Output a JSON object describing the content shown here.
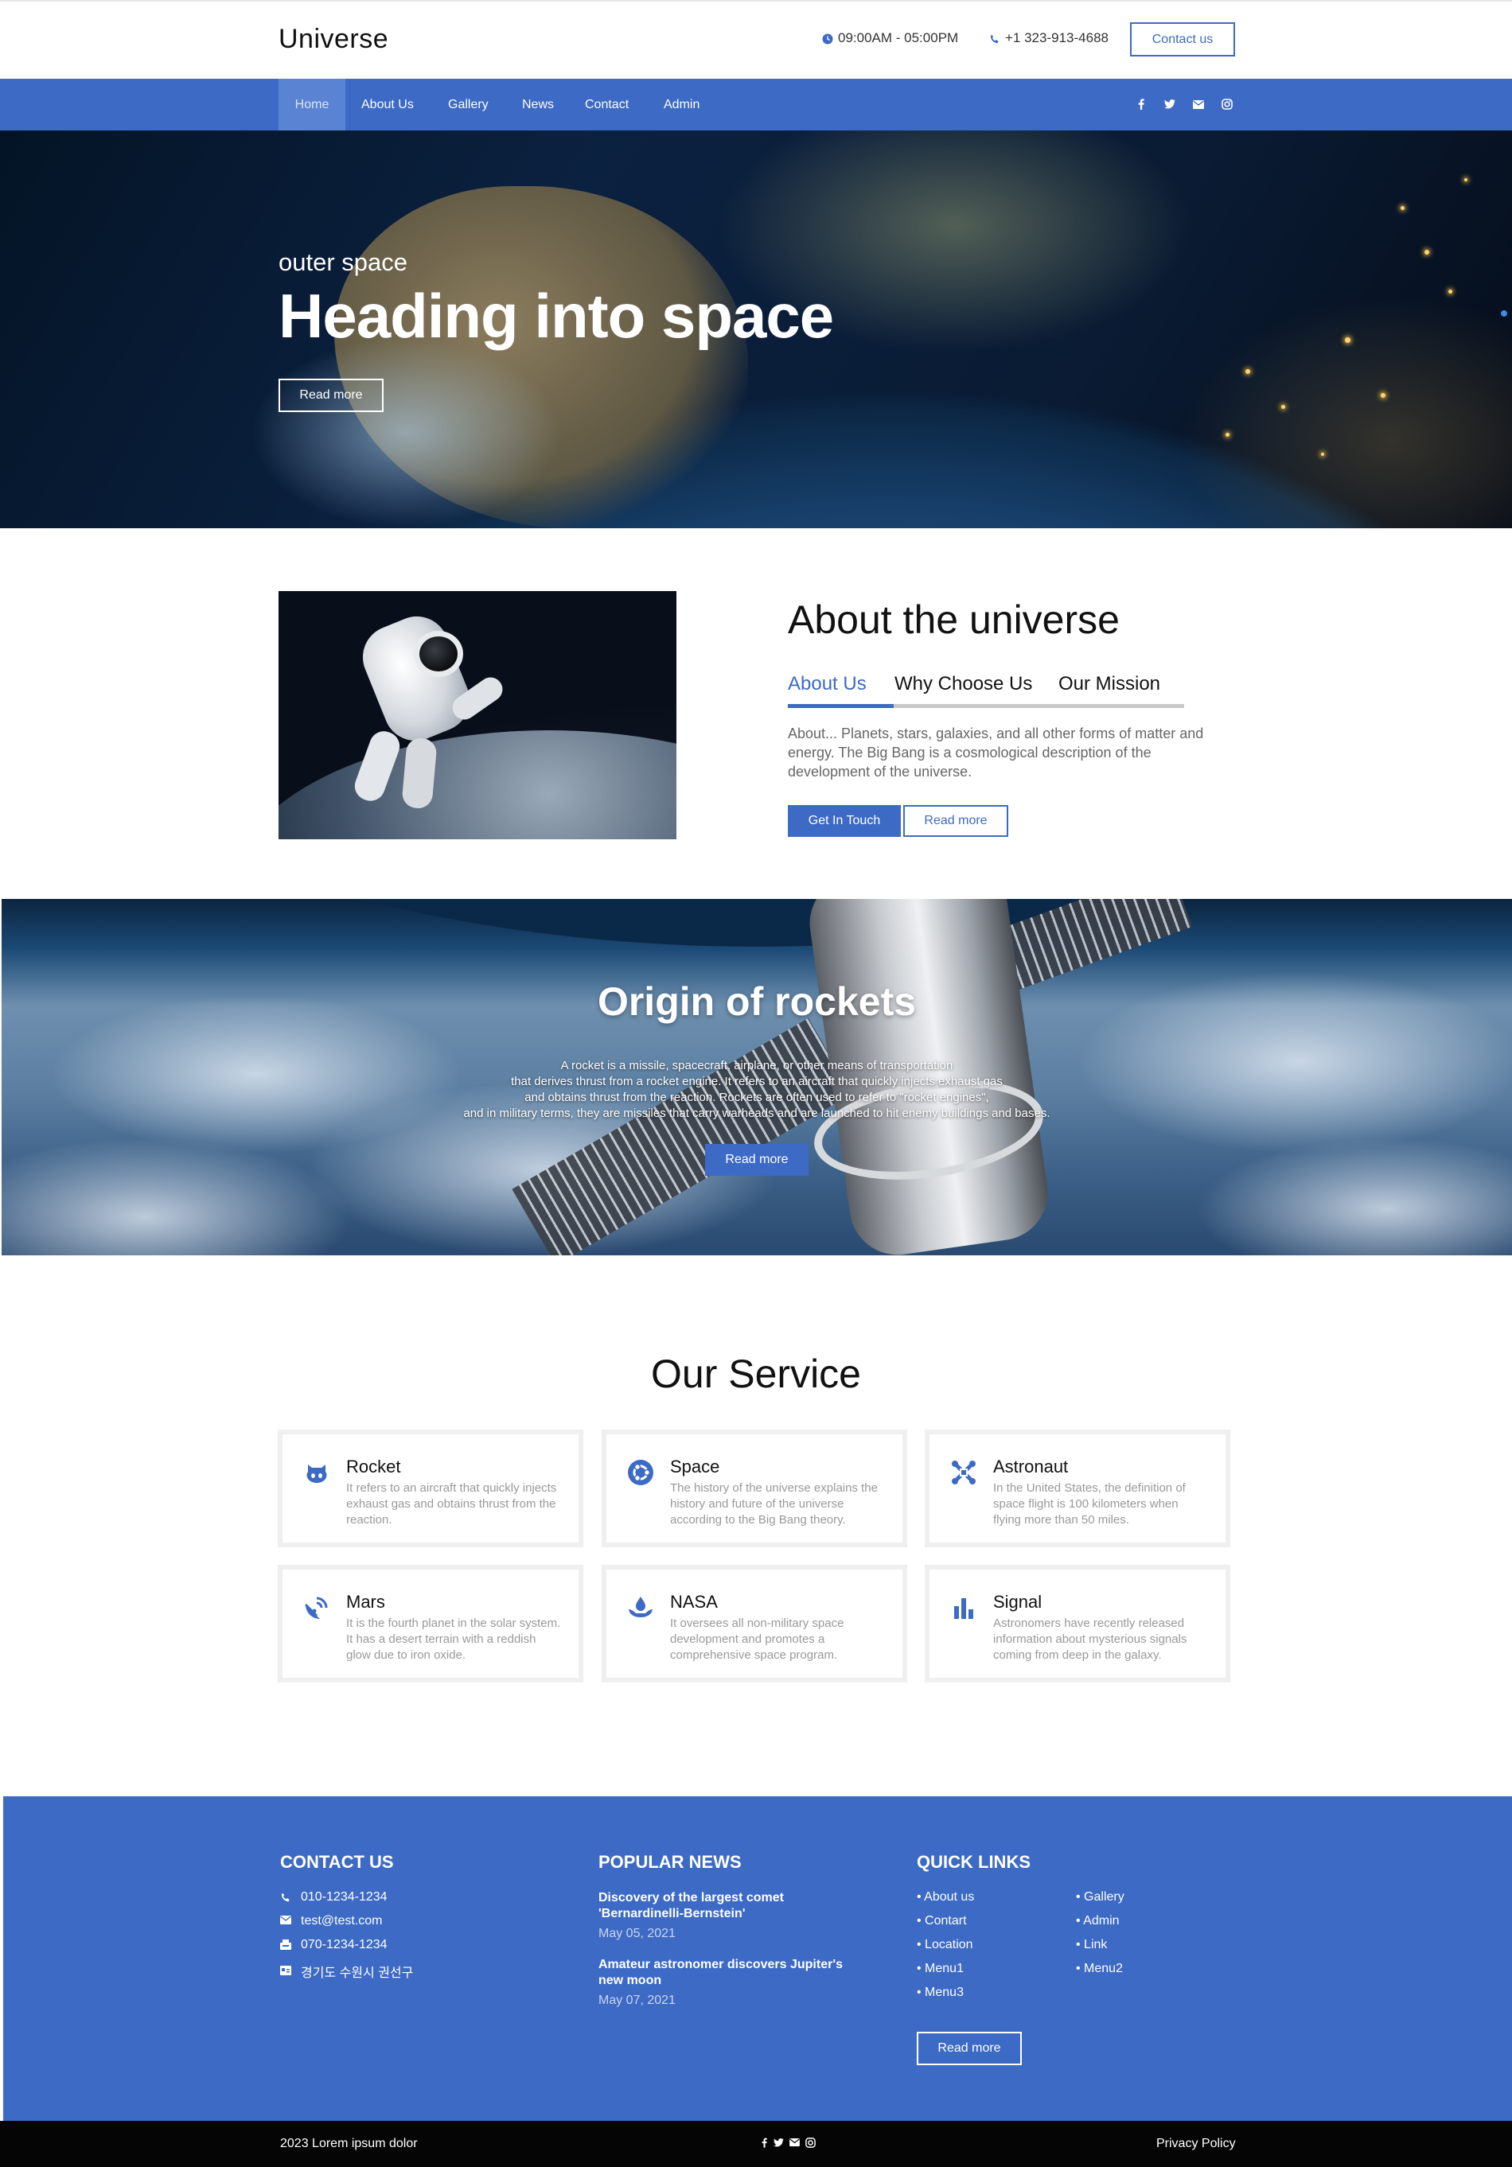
{
  "header": {
    "brand": "Universe",
    "hours": "09:00AM - 05:00PM",
    "phone": "+1 323-913-4688",
    "contact_button": "Contact us"
  },
  "nav": {
    "items": [
      "Home",
      "About Us",
      "Gallery",
      "News",
      "Contact",
      "Admin"
    ],
    "active": "Home",
    "social": [
      "facebook-icon",
      "twitter-icon",
      "mail-icon",
      "instagram-icon"
    ]
  },
  "hero": {
    "subtitle": "outer space",
    "title": "Heading into space",
    "button": "Read more"
  },
  "about": {
    "title": "About the universe",
    "tabs": [
      "About Us",
      "Why Choose Us",
      "Our Mission"
    ],
    "active_tab": "About Us",
    "text": "About... Planets, stars, galaxies, and all other forms of matter and energy. The Big Bang is a cosmological description of the development of the universe.",
    "primary_button": "Get In Touch",
    "secondary_button": "Read more"
  },
  "rockets": {
    "title": "Origin of rockets",
    "lines": [
      "A rocket is a missile, spacecraft, airplane, or other means of transportation",
      "that derives thrust from a rocket engine. It refers to an aircraft that quickly injects exhaust gas",
      "and obtains thrust from the reaction. Rockets are often used to refer to \"rocket engines\",",
      "and in military terms, they are missiles that carry warheads and are launched to hit enemy buildings and bases."
    ],
    "button": "Read more"
  },
  "services": {
    "title": "Our Service",
    "items": [
      {
        "name": "Rocket",
        "icon": "github-icon",
        "desc": "It refers to an aircraft that quickly injects exhaust gas and obtains thrust from the reaction."
      },
      {
        "name": "Space",
        "icon": "ubuntu-icon",
        "desc": "The history of the universe explains the history and future of the universe according to the Big Bang theory."
      },
      {
        "name": "Astronaut",
        "icon": "joomla-icon",
        "desc": "In the United States, the definition of space flight is 100 kilometers when flying more than 50 miles."
      },
      {
        "name": "Mars",
        "icon": "satellite-dish-icon",
        "desc": "It is the fourth planet in the solar system. It has a desert terrain with a reddish glow due to iron oxide."
      },
      {
        "name": "NASA",
        "icon": "hand-drop-icon",
        "desc": "It oversees all non-military space development and promotes a comprehensive space program."
      },
      {
        "name": "Signal",
        "icon": "bar-chart-icon",
        "desc": "Astronomers have recently released information about mysterious signals coming from deep in the galaxy."
      }
    ]
  },
  "footer": {
    "contact_heading": "CONTACT US",
    "contacts": [
      {
        "icon": "phone-icon",
        "text": "010-1234-1234"
      },
      {
        "icon": "mail-icon",
        "text": "test@test.com"
      },
      {
        "icon": "fax-icon",
        "text": "070-1234-1234"
      },
      {
        "icon": "address-card-icon",
        "text": "경기도 수원시 권선구"
      }
    ],
    "news_heading": "POPULAR NEWS",
    "news": [
      {
        "title": "Discovery of the largest comet 'Bernardinelli-Bernstein'",
        "date": "May 05, 2021"
      },
      {
        "title": "Amateur astronomer discovers Jupiter's new moon",
        "date": "May 07, 2021"
      }
    ],
    "links_heading": "QUICK LINKS",
    "links_col1": [
      "About us",
      "Contart",
      "Location",
      "Menu1",
      "Menu3"
    ],
    "links_col2": [
      "Gallery",
      "Admin",
      "Link",
      "Menu2"
    ],
    "button": "Read more"
  },
  "bottom": {
    "copyright": "2023 Lorem ipsum dolor",
    "privacy": "Privacy Policy",
    "social": [
      "facebook-icon",
      "twitter-icon",
      "mail-icon",
      "instagram-icon"
    ]
  },
  "colors": {
    "accent": "#3d6ac4",
    "footer_bar": "#050505"
  }
}
